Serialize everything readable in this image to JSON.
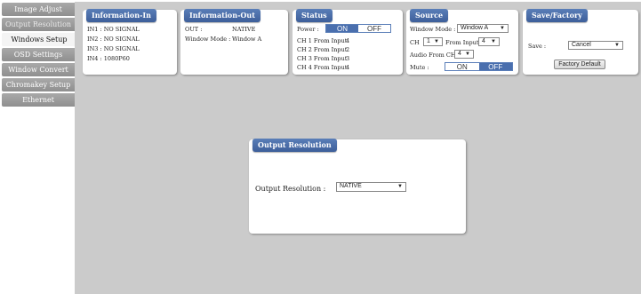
{
  "sidebar": {
    "items": [
      {
        "label": "Image Adjust"
      },
      {
        "label": "Output Resolution"
      },
      {
        "label": "Windows Setup"
      },
      {
        "label": "OSD Settings"
      },
      {
        "label": "Window Convert"
      },
      {
        "label": "Chromakey Setup"
      },
      {
        "label": "Ethernet"
      }
    ]
  },
  "info_in": {
    "title": "Information-In",
    "lines": [
      "IN1 : NO SIGNAL",
      "IN2 : NO SIGNAL",
      "IN3 : NO SIGNAL",
      "IN4 : 1080P60"
    ]
  },
  "info_out": {
    "title": "Information-Out",
    "out_label": "OUT :",
    "out_value": "NATIVE",
    "mode_label": "Window Mode :",
    "mode_value": "Window A"
  },
  "status": {
    "title": "Status",
    "power_label": "Power :",
    "on_label": "ON",
    "off_label": "OFF",
    "channels": [
      {
        "label": "CH 1 From Input",
        "value": "4"
      },
      {
        "label": "CH 2 From Input",
        "value": "2"
      },
      {
        "label": "CH 3 From Input",
        "value": "3"
      },
      {
        "label": "CH 4 From Input",
        "value": "4"
      }
    ]
  },
  "source": {
    "title": "Source",
    "window_mode_label": "Window Mode :",
    "window_mode_value": "Window A",
    "ch_label": "CH",
    "ch_value": "1",
    "from_input_label": "From Input",
    "from_input_value": "4",
    "audio_label": "Audio From CH",
    "audio_value": "4",
    "mute_label": "Mute :",
    "on_label": "ON",
    "off_label": "OFF"
  },
  "save_factory": {
    "title": "Save/Factory",
    "save_label": "Save :",
    "save_value": "Cancel",
    "factory_button": "Factory Default"
  },
  "output_resolution": {
    "title": "Output Resolution",
    "label": "Output Resolution :",
    "value": "NATIVE"
  },
  "colors": {
    "accent": "#4a6fae",
    "background": "#cbcbcb"
  }
}
